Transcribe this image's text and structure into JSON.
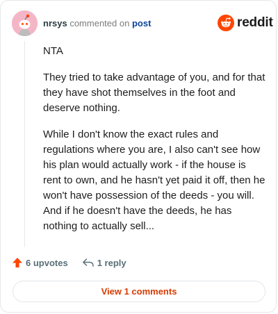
{
  "comment": {
    "username": "nrsys",
    "action_text": "commented on",
    "post_link": "post",
    "paragraphs": [
      "NTA",
      "They tried to take advantage of you, and for that they have shot themselves in the foot and deserve nothing.",
      "While I don't know the exact rules and regulations where you are, I also can't see how his plan would actually work - if the house is rent to own, and he hasn't yet paid it off, then he won't have possession of the deeds - you will. And if he doesn't have the deeds, he has nothing to actually sell..."
    ]
  },
  "brand": {
    "name": "reddit",
    "color": "#ff4500"
  },
  "actions": {
    "upvotes_label": "6 upvotes",
    "reply_label": "1 reply",
    "upvote_color": "#ff4500"
  },
  "footer": {
    "view_comments_label": "View 1 comments",
    "link_color": "#d93a00"
  },
  "icons": {
    "avatar": "snoo-avatar-icon",
    "logo": "reddit-snoo-icon",
    "upvote": "upvote-arrow-icon",
    "reply": "reply-arrow-icon"
  }
}
